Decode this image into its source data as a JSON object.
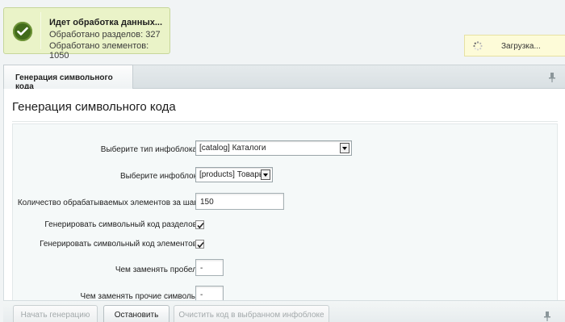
{
  "notification": {
    "title": "Идет обработка данных...",
    "sections_line": "Обработано разделов: 327",
    "elements_line": "Обработано элементов: 1050"
  },
  "loading": {
    "text": "Загрузка..."
  },
  "tabs": [
    {
      "label": "Генерация символьного кода",
      "active": true
    }
  ],
  "page": {
    "title": "Генерация символьного кода"
  },
  "form": {
    "iblock_type": {
      "label": "Выберите тип инфоблока",
      "value": "[catalog] Каталоги"
    },
    "iblock": {
      "label": "Выберите инфоблок",
      "value": "[products] Товары"
    },
    "step_count": {
      "label": "Количество обрабатываемых элементов за шаг",
      "value": "150"
    },
    "gen_sections": {
      "label": "Генерировать символьный код разделов",
      "checked": true
    },
    "gen_elements": {
      "label": "Генерировать символьный код элементов",
      "checked": true
    },
    "space_replace": {
      "label": "Чем заменять пробел",
      "value": "-"
    },
    "other_replace": {
      "label": "Чем заменять прочие символы",
      "value": "-"
    }
  },
  "toolbar": {
    "start_label": "Начать генерацию",
    "stop_label": "Остановить",
    "clear_label": "Очистить код в выбранном инфоблоке"
  },
  "colors": {
    "success": "#426b1b",
    "notify_bg": "#eaf3c8",
    "loading_bg": "#fdfbd8"
  },
  "icons": {
    "success": "check-icon",
    "loading": "spinner-icon",
    "pin": "pin-icon"
  }
}
